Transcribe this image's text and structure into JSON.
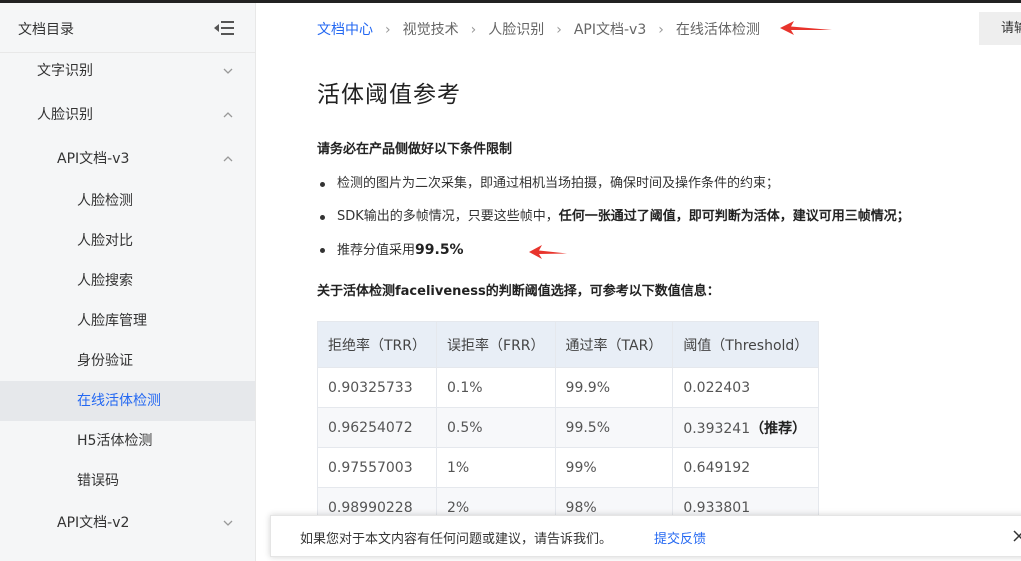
{
  "sidebar": {
    "title": "文档目录",
    "items": [
      {
        "label": "文字识别",
        "level": 1,
        "chevron": "down"
      },
      {
        "label": "人脸识别",
        "level": 1,
        "chevron": "up"
      },
      {
        "label": "API文档-v3",
        "level": 2,
        "chevron": "up"
      },
      {
        "label": "人脸检测",
        "level": 3
      },
      {
        "label": "人脸对比",
        "level": 3
      },
      {
        "label": "人脸搜索",
        "level": 3
      },
      {
        "label": "人脸库管理",
        "level": 3
      },
      {
        "label": "身份验证",
        "level": 3
      },
      {
        "label": "在线活体检测",
        "level": 3,
        "active": true
      },
      {
        "label": "H5活体检测",
        "level": 3
      },
      {
        "label": "错误码",
        "level": 3
      },
      {
        "label": "API文档-v2",
        "level": 2,
        "chevron": "down"
      }
    ]
  },
  "breadcrumb": [
    "文档中心",
    "视觉技术",
    "人脸识别",
    "API文档-v3",
    "在线活体检测"
  ],
  "help_button": "请输",
  "page": {
    "title": "活体阈值参考",
    "requirement_title": "请务必在产品侧做好以下条件限制",
    "bullet1": "检测的图片为二次采集，即通过相机当场拍摄，确保时间及操作条件的约束；",
    "bullet2_plain": "SDK输出的多帧情况，只要这些帧中，",
    "bullet2_strong": "任何一张通过了阈值，即可判断为活体，建议可用三帧情况；",
    "bullet3_plain": "推荐分值采用",
    "bullet3_value": "99.5%",
    "threshold_question": "关于活体检测faceliveness的判断阈值选择，可参考以下数值信息："
  },
  "table": {
    "headers": [
      "拒绝率（TRR）",
      "误拒率（FRR）",
      "通过率（TAR）",
      "阈值（Threshold）"
    ],
    "rows": [
      [
        "0.90325733",
        "0.1%",
        "99.9%",
        "0.022403"
      ],
      [
        "0.96254072",
        "0.5%",
        "99.5%",
        "0.393241"
      ],
      [
        "0.97557003",
        "1%",
        "99%",
        "0.649192"
      ],
      [
        "0.98990228",
        "2%",
        "98%",
        "0.933801"
      ]
    ],
    "recommended_label": "（推荐）"
  },
  "feedback": {
    "text": "如果您对于本文内容有任何问题或建议，请告诉我们。",
    "link": "提交反馈"
  },
  "colors": {
    "link": "#2468f2",
    "annotation_arrow": "#e8342c",
    "active_bg": "#e6e8eb"
  }
}
